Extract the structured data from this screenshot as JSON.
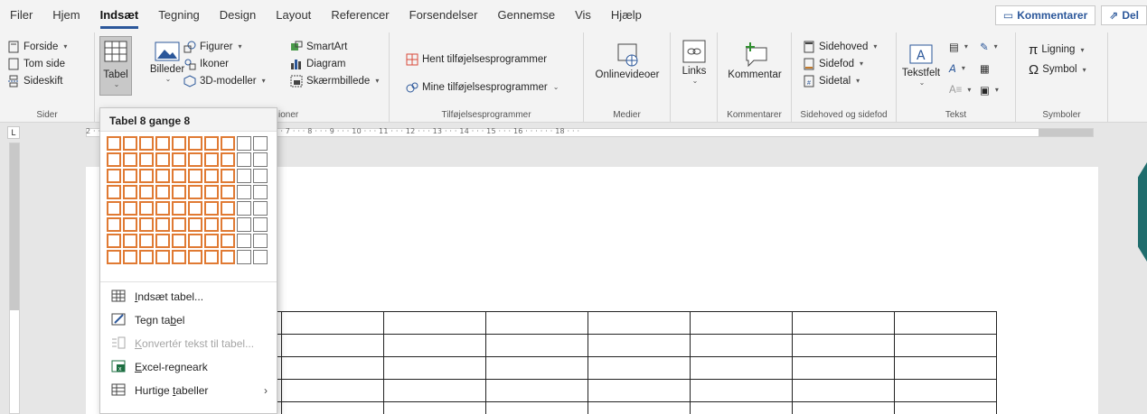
{
  "tabs": [
    "Filer",
    "Hjem",
    "Indsæt",
    "Tegning",
    "Design",
    "Layout",
    "Referencer",
    "Forsendelser",
    "Gennemse",
    "Vis",
    "Hjælp"
  ],
  "active_tab": "Indsæt",
  "top_right": {
    "comments": "Kommentarer",
    "share": "Del"
  },
  "ribbon": {
    "pages": {
      "forside": "Forside",
      "tom_side": "Tom side",
      "sideskift": "Sideskift",
      "label": "Sider"
    },
    "table": {
      "tabel": "Tabel"
    },
    "illustrations": {
      "billeder": "Billeder",
      "figurer": "Figurer",
      "ikoner": "Ikoner",
      "modeller": "3D-modeller",
      "smartart": "SmartArt",
      "diagram": "Diagram",
      "skaermbillede": "Skærmbillede",
      "label_partial": "ioner"
    },
    "addins": {
      "hent": "Hent tilføjelsesprogrammer",
      "mine": "Mine tilføjelsesprogrammer",
      "label": "Tilføjelsesprogrammer"
    },
    "media": {
      "onlinevideoer": "Onlinevideoer",
      "label": "Medier"
    },
    "links": {
      "links": "Links"
    },
    "comments": {
      "kommentar": "Kommentar",
      "label": "Kommentarer"
    },
    "header_footer": {
      "sidehoved": "Sidehoved",
      "sidefod": "Sidefod",
      "sidetal": "Sidetal",
      "label": "Sidehoved og sidefod"
    },
    "text": {
      "tekstfelt": "Tekstfelt",
      "label": "Tekst"
    },
    "symbols": {
      "ligning": "Ligning",
      "symbol": "Symbol",
      "label": "Symboler"
    }
  },
  "ruler": {
    "ticks": "2 · · · 1 · · · · · · · · · · · · 2 · · · 3 · · · 4 · · · 5 · · · 6 · · · 7 · · · 8 · · · 9 · · · 10 · · · 11 · · · 12 · · · 13 · · · 14 · · · 15 · · · 16 · · · · · · 18 · · ·",
    "corner": "L"
  },
  "dropdown": {
    "title": "Tabel 8 gange 8",
    "grid_rows": 8,
    "grid_cols": 10,
    "selected_rows": 8,
    "selected_cols": 8,
    "items": [
      {
        "pre": "",
        "u": "I",
        "post": "ndsæt tabel...",
        "disabled": false
      },
      {
        "pre": "Tegn ta",
        "u": "b",
        "post": "el",
        "disabled": false
      },
      {
        "pre": "",
        "u": "K",
        "post": "onvertér tekst til tabel...",
        "disabled": true
      },
      {
        "pre": "",
        "u": "E",
        "post": "xcel-regneark",
        "disabled": false
      },
      {
        "pre": "Hurtige ",
        "u": "t",
        "post": "abeller",
        "disabled": false
      }
    ]
  },
  "colors": {
    "accent": "#2b579a",
    "grid_highlight": "#e07a33"
  }
}
